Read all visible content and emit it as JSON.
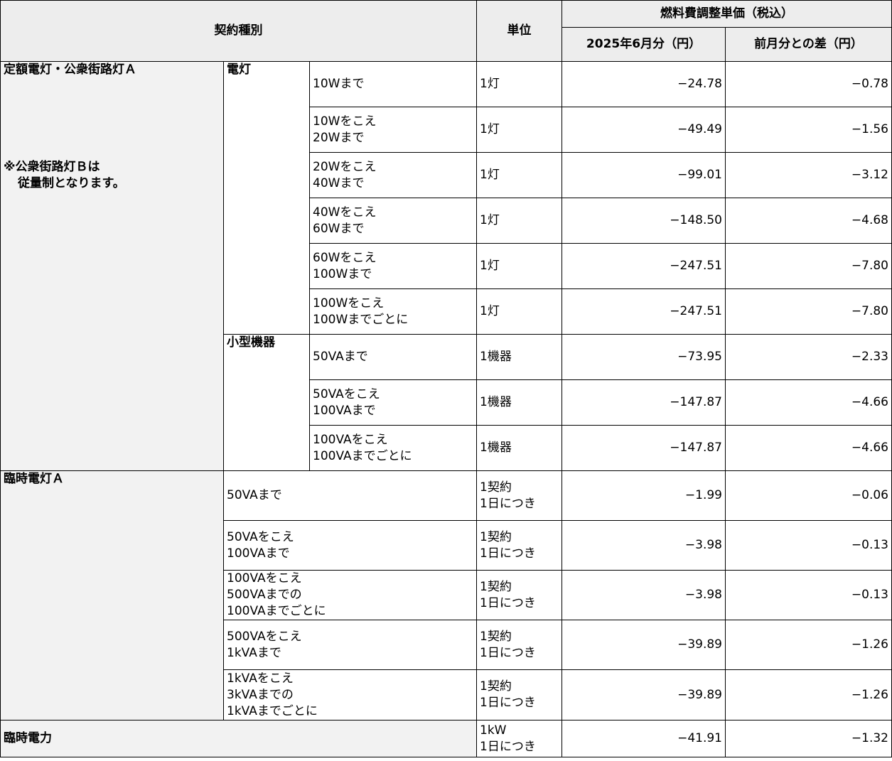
{
  "header": {
    "contract_type": "契約種別",
    "unit": "単位",
    "price_group": "燃料費調整単価（税込）",
    "current_month": "2025年6月分（円）",
    "diff": "前月分との差（円）"
  },
  "teigaku": {
    "label": "定額電灯・公衆街路灯Ａ",
    "note_line1": "※公衆街路灯Ｂは",
    "note_line2": "従量制となります。",
    "dento": {
      "label": "電灯",
      "rows": [
        {
          "range": "10Wまで",
          "unit": "1灯",
          "price": "−24.78",
          "diff": "−0.78"
        },
        {
          "range": "10Wをこえ\n20Wまで",
          "unit": "1灯",
          "price": "−49.49",
          "diff": "−1.56"
        },
        {
          "range": "20Wをこえ\n40Wまで",
          "unit": "1灯",
          "price": "−99.01",
          "diff": "−3.12"
        },
        {
          "range": "40Wをこえ\n60Wまで",
          "unit": "1灯",
          "price": "−148.50",
          "diff": "−4.68"
        },
        {
          "range": "60Wをこえ\n100Wまで",
          "unit": "1灯",
          "price": "−247.51",
          "diff": "−7.80"
        },
        {
          "range": "100Wをこえ\n100Wまでごとに",
          "unit": "1灯",
          "price": "−247.51",
          "diff": "−7.80"
        }
      ]
    },
    "kogata": {
      "label": "小型機器",
      "rows": [
        {
          "range": "50VAまで",
          "unit": "1機器",
          "price": "−73.95",
          "diff": "−2.33"
        },
        {
          "range": "50VAをこえ\n100VAまで",
          "unit": "1機器",
          "price": "−147.87",
          "diff": "−4.66"
        },
        {
          "range": "100VAをこえ\n100VAまでごとに",
          "unit": "1機器",
          "price": "−147.87",
          "diff": "−4.66"
        }
      ]
    }
  },
  "rinji_dento": {
    "label": "臨時電灯Ａ",
    "rows": [
      {
        "range": "50VAまで",
        "unit": "1契約\n1日につき",
        "price": "−1.99",
        "diff": "−0.06"
      },
      {
        "range": "50VAをこえ\n100VAまで",
        "unit": "1契約\n1日につき",
        "price": "−3.98",
        "diff": "−0.13"
      },
      {
        "range": "100VAをこえ\n500VAまでの\n100VAまでごとに",
        "unit": "1契約\n1日につき",
        "price": "−3.98",
        "diff": "−0.13"
      },
      {
        "range": "500VAをこえ\n1kVAまで",
        "unit": "1契約\n1日につき",
        "price": "−39.89",
        "diff": "−1.26"
      },
      {
        "range": "1kVAをこえ\n3kVAまでの\n1kVAまでごとに",
        "unit": "1契約\n1日につき",
        "price": "−39.89",
        "diff": "−1.26"
      }
    ]
  },
  "rinji_denryoku": {
    "label": "臨時電力",
    "unit": "1kW\n1日につき",
    "price": "−41.91",
    "diff": "−1.32"
  }
}
